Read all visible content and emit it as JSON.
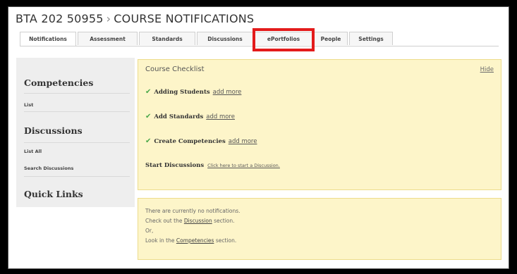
{
  "header": {
    "course": "BTA 202 50955",
    "separator": "›",
    "page": "COURSE NOTIFICATIONS"
  },
  "tabs": [
    {
      "label": "Notifications",
      "active": true
    },
    {
      "label": "Assessment"
    },
    {
      "label": "Standards"
    },
    {
      "label": "Discussions"
    },
    {
      "label": "ePortfolios",
      "highlighted": true
    },
    {
      "label": "People"
    },
    {
      "label": "Settings"
    }
  ],
  "sidebar": {
    "competencies_heading": "Competencies",
    "competencies_links": [
      "List"
    ],
    "discussions_heading": "Discussions",
    "discussions_links": [
      "List All",
      "Search Discussions"
    ],
    "quick_links_heading": "Quick Links"
  },
  "checklist": {
    "title": "Course Checklist",
    "hide_label": "Hide",
    "items": [
      {
        "label": "Adding Students",
        "link": "add more",
        "checked": true
      },
      {
        "label": "Add Standards",
        "link": "add more",
        "checked": true
      },
      {
        "label": "Create Competencies",
        "link": "add more",
        "checked": true
      }
    ],
    "start": {
      "label": "Start Discussions",
      "link": "Click here to start a Discussion."
    }
  },
  "notifications": {
    "line1": "There are currently no notifications.",
    "line2_pre": "Check out the",
    "line2_link": "Discussion",
    "line2_post": "section.",
    "line3": "Or,",
    "line4_pre": "Look in the",
    "line4_link": "Competencies",
    "line4_post": "section."
  },
  "colors": {
    "highlight": "#e31b1b",
    "panel_bg": "#fdf5c9",
    "check": "#4aa84a",
    "sidebar_bg": "#eeeeee"
  }
}
